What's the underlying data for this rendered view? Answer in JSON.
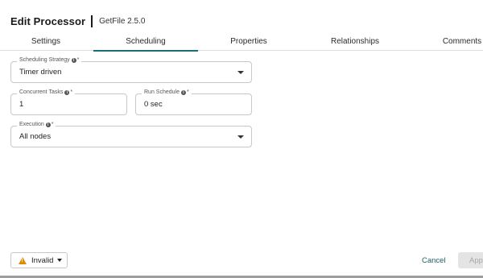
{
  "header": {
    "title": "Edit Processor",
    "subtitle": "GetFile 2.5.0"
  },
  "tabs": [
    {
      "label": "Settings"
    },
    {
      "label": "Scheduling",
      "active": true
    },
    {
      "label": "Properties"
    },
    {
      "label": "Relationships"
    },
    {
      "label": "Comments"
    }
  ],
  "fields": {
    "scheduling_strategy": {
      "label": "Scheduling Strategy",
      "required": "*",
      "value": "Timer driven"
    },
    "concurrent_tasks": {
      "label": "Concurrent Tasks",
      "required": "*",
      "value": "1"
    },
    "run_schedule": {
      "label": "Run Schedule",
      "required": "*",
      "value": "0 sec"
    },
    "execution": {
      "label": "Execution",
      "required": "*",
      "value": "All nodes"
    }
  },
  "footer": {
    "status_label": "Invalid",
    "cancel_label": "Cancel",
    "apply_label": "Apply"
  },
  "colors": {
    "accent": "#1b6e73",
    "warning": "#e08a00",
    "disabled_bg": "#e4e4e4"
  },
  "icons": {
    "info": "info-icon",
    "warning": "warning-icon",
    "dropdown": "chevron-down-icon"
  }
}
